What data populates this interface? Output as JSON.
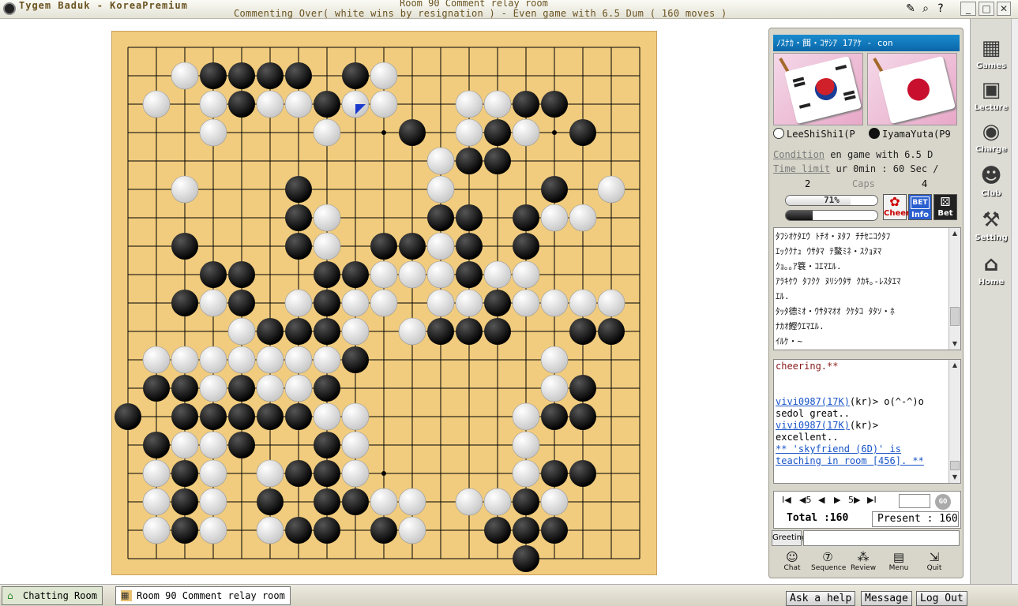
{
  "window": {
    "app_title": "Tygem Baduk - KoreaPremium",
    "room_title": "Room 90 Comment relay room",
    "status": "Commenting Over( white wins by resignation ) - Even game with 6.5 Dum  ( 160 moves )"
  },
  "game_panel": {
    "header": "ﾉｽﾅｶ・餌・ｺｻｼｱ 17ｱｹ  - con",
    "players": {
      "white": "LeeShiShi1(P",
      "black": "IyamaYuta(P9"
    },
    "condition_label": "Condition",
    "condition_value": "en game with 6.5 D",
    "timelimit_label": "Time limit",
    "timelimit_value": "ur 0min : 60 Sec /",
    "caps_label": "Caps",
    "white_caps": "2",
    "black_caps": "4",
    "white_win_pct": 71,
    "white_win_label": "71%",
    "black_win_pct": 29,
    "black_win_label": "29%",
    "buttons": {
      "cheer": "Cheer",
      "info": "Info",
      "bet": "Bet",
      "bet_badge": "BET"
    }
  },
  "commentary": [
    "ﾀﾌｼｵｹﾀｴｳ ﾄﾁｵ・ﾇﾀﾌ ﾁﾁｾﾆｺｸﾀﾌ",
    "ｴｯｸｸﾅｭ ｳｻﾀﾏ ﾃ鰲ﾐﾈ・ｽｸｮﾇﾏ",
    "ｸｮ｡｡ｱ簔・ｺｴﾏｴﾙ.",
    "ｱﾗｷｹｳ ﾀﾌｸｸ ﾇﾘｼｳﾀｻ ｸｶｷ｡-ﾚｽﾀｴﾏ",
    "ｴﾙ.",
    "ﾀｯﾀ德ﾐｵ・ｳｻﾀﾏｵｵ ｸｹﾀｺ ﾀﾀｿ・ﾎ",
    "ﾅｶｵ鰹ｳｴﾏｴﾙ.",
    "ｲﾙｹ・~"
  ],
  "chat": [
    {
      "user": "",
      "text": "cheering.**",
      "kind": "system"
    },
    {
      "user": "",
      "text": "",
      "kind": "blank"
    },
    {
      "user": "",
      "text": "",
      "kind": "blank"
    },
    {
      "user": "vivi0987(17K)",
      "text": "(kr)> o(^-^)o",
      "kind": "user"
    },
    {
      "user": "",
      "text": "sedol great..",
      "kind": "plain"
    },
    {
      "user": "vivi0987(17K)",
      "text": "(kr)>",
      "kind": "user"
    },
    {
      "user": "",
      "text": "excellent..",
      "kind": "plain"
    },
    {
      "user": "",
      "text": "** 'skyfriend (6D)' is",
      "kind": "link"
    },
    {
      "user": "",
      "text": "teaching in room [456]. **",
      "kind": "link"
    }
  ],
  "navigation": {
    "first": "I◀",
    "back_n": "◀5",
    "back": "◀",
    "forward": "▶",
    "forward_n": "5▶",
    "last": "▶I",
    "go": "GO",
    "total_label": "Total :160",
    "present_label": "Present : 160"
  },
  "greeting": {
    "label": "Greeting",
    "value": ""
  },
  "bottom_buttons": [
    {
      "label": "Chat",
      "icon": "chat-icon",
      "glyph": "☺"
    },
    {
      "label": "Sequence",
      "icon": "sequence-icon",
      "glyph": "⑦"
    },
    {
      "label": "Review",
      "icon": "review-icon",
      "glyph": "⁂"
    },
    {
      "label": "Menu",
      "icon": "menu-icon",
      "glyph": "▤"
    },
    {
      "label": "Quit",
      "icon": "quit-icon",
      "glyph": "⇲"
    }
  ],
  "sidebar": [
    {
      "label": "Games",
      "icon": "games-icon",
      "glyph": "▦"
    },
    {
      "label": "Lecture",
      "icon": "lecture-icon",
      "glyph": "▣"
    },
    {
      "label": "Charge",
      "icon": "charge-icon",
      "glyph": "◉"
    },
    {
      "label": "Club",
      "icon": "club-icon",
      "glyph": "☻"
    },
    {
      "label": "Setting",
      "icon": "setting-icon",
      "glyph": "⚒"
    },
    {
      "label": "Home",
      "icon": "home-icon",
      "glyph": "⌂"
    }
  ],
  "taskbar": {
    "tab1": "Chatting Room",
    "tab2": "Room 90 Comment relay room",
    "help": "Ask a help",
    "message": "Message",
    "logout": "Log Out"
  },
  "board": {
    "size": 19,
    "last_move": [
      8,
      2
    ],
    "black": [
      [
        3,
        1
      ],
      [
        4,
        1
      ],
      [
        5,
        1
      ],
      [
        6,
        1
      ],
      [
        8,
        1
      ],
      [
        4,
        2
      ],
      [
        7,
        2
      ],
      [
        14,
        2
      ],
      [
        15,
        2
      ],
      [
        10,
        3
      ],
      [
        13,
        3
      ],
      [
        16,
        3
      ],
      [
        12,
        4
      ],
      [
        13,
        4
      ],
      [
        6,
        5
      ],
      [
        15,
        5
      ],
      [
        6,
        6
      ],
      [
        11,
        6
      ],
      [
        12,
        6
      ],
      [
        14,
        6
      ],
      [
        2,
        7
      ],
      [
        6,
        7
      ],
      [
        9,
        7
      ],
      [
        10,
        7
      ],
      [
        12,
        7
      ],
      [
        14,
        7
      ],
      [
        3,
        8
      ],
      [
        4,
        8
      ],
      [
        7,
        8
      ],
      [
        8,
        8
      ],
      [
        12,
        8
      ],
      [
        2,
        9
      ],
      [
        4,
        9
      ],
      [
        7,
        9
      ],
      [
        13,
        9
      ],
      [
        5,
        10
      ],
      [
        6,
        10
      ],
      [
        7,
        10
      ],
      [
        11,
        10
      ],
      [
        12,
        10
      ],
      [
        13,
        10
      ],
      [
        16,
        10
      ],
      [
        17,
        10
      ],
      [
        8,
        11
      ],
      [
        1,
        12
      ],
      [
        2,
        12
      ],
      [
        4,
        12
      ],
      [
        7,
        12
      ],
      [
        16,
        12
      ],
      [
        0,
        13
      ],
      [
        2,
        13
      ],
      [
        3,
        13
      ],
      [
        4,
        13
      ],
      [
        5,
        13
      ],
      [
        6,
        13
      ],
      [
        15,
        13
      ],
      [
        16,
        13
      ],
      [
        1,
        14
      ],
      [
        4,
        14
      ],
      [
        7,
        14
      ],
      [
        2,
        15
      ],
      [
        6,
        15
      ],
      [
        7,
        15
      ],
      [
        15,
        15
      ],
      [
        16,
        15
      ],
      [
        2,
        16
      ],
      [
        5,
        16
      ],
      [
        7,
        16
      ],
      [
        8,
        16
      ],
      [
        14,
        16
      ],
      [
        2,
        17
      ],
      [
        6,
        17
      ],
      [
        7,
        17
      ],
      [
        9,
        17
      ],
      [
        13,
        17
      ],
      [
        14,
        17
      ],
      [
        15,
        17
      ],
      [
        14,
        18
      ]
    ],
    "white": [
      [
        2,
        1
      ],
      [
        9,
        1
      ],
      [
        1,
        2
      ],
      [
        3,
        2
      ],
      [
        5,
        2
      ],
      [
        6,
        2
      ],
      [
        8,
        2
      ],
      [
        9,
        2
      ],
      [
        12,
        2
      ],
      [
        13,
        2
      ],
      [
        3,
        3
      ],
      [
        7,
        3
      ],
      [
        12,
        3
      ],
      [
        14,
        3
      ],
      [
        11,
        4
      ],
      [
        2,
        5
      ],
      [
        11,
        5
      ],
      [
        17,
        5
      ],
      [
        7,
        6
      ],
      [
        15,
        6
      ],
      [
        16,
        6
      ],
      [
        7,
        7
      ],
      [
        11,
        7
      ],
      [
        9,
        8
      ],
      [
        10,
        8
      ],
      [
        11,
        8
      ],
      [
        13,
        8
      ],
      [
        14,
        8
      ],
      [
        3,
        9
      ],
      [
        6,
        9
      ],
      [
        8,
        9
      ],
      [
        9,
        9
      ],
      [
        11,
        9
      ],
      [
        12,
        9
      ],
      [
        14,
        9
      ],
      [
        15,
        9
      ],
      [
        16,
        9
      ],
      [
        17,
        9
      ],
      [
        4,
        10
      ],
      [
        8,
        10
      ],
      [
        10,
        10
      ],
      [
        1,
        11
      ],
      [
        2,
        11
      ],
      [
        3,
        11
      ],
      [
        4,
        11
      ],
      [
        5,
        11
      ],
      [
        6,
        11
      ],
      [
        7,
        11
      ],
      [
        15,
        11
      ],
      [
        3,
        12
      ],
      [
        5,
        12
      ],
      [
        6,
        12
      ],
      [
        15,
        12
      ],
      [
        7,
        13
      ],
      [
        8,
        13
      ],
      [
        14,
        13
      ],
      [
        2,
        14
      ],
      [
        3,
        14
      ],
      [
        8,
        14
      ],
      [
        14,
        14
      ],
      [
        1,
        15
      ],
      [
        3,
        15
      ],
      [
        5,
        15
      ],
      [
        8,
        15
      ],
      [
        14,
        15
      ],
      [
        1,
        16
      ],
      [
        3,
        16
      ],
      [
        9,
        16
      ],
      [
        10,
        16
      ],
      [
        12,
        16
      ],
      [
        13,
        16
      ],
      [
        15,
        16
      ],
      [
        1,
        17
      ],
      [
        3,
        17
      ],
      [
        5,
        17
      ],
      [
        10,
        17
      ]
    ]
  }
}
